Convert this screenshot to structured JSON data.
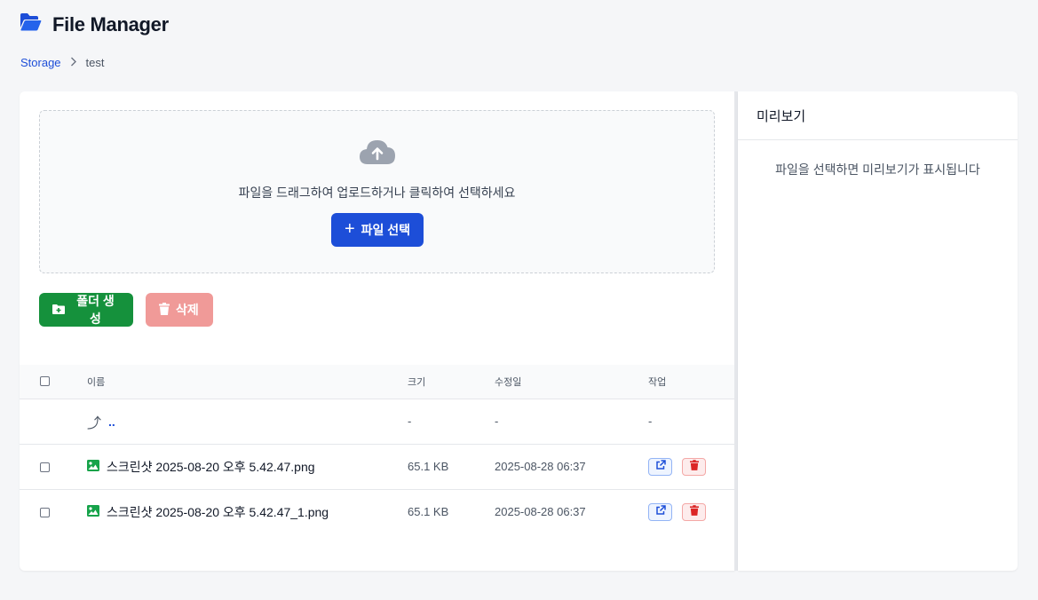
{
  "app": {
    "title": "File Manager",
    "icon": "folder-open-icon"
  },
  "breadcrumb": {
    "root": "Storage",
    "separator_icon": "chevron-right-icon",
    "current": "test"
  },
  "upload": {
    "icon": "cloud-upload-icon",
    "hint": "파일을 드래그하여 업로드하거나 클릭하여 선택하세요",
    "select_button": "파일 선택"
  },
  "toolbar": {
    "create_folder": "폴더 생성",
    "delete": "삭제"
  },
  "table": {
    "headers": {
      "name": "이름",
      "size": "크기",
      "modified": "수정일",
      "actions": "작업"
    },
    "parent_row": {
      "name": "..",
      "size": "-",
      "modified": "-",
      "actions": "-"
    },
    "rows": [
      {
        "name": "스크린샷 2025-08-20 오후 5.42.47.png",
        "size": "65.1 KB",
        "modified": "2025-08-28 06:37",
        "icon": "image-icon"
      },
      {
        "name": "스크린샷 2025-08-20 오후 5.42.47_1.png",
        "size": "65.1 KB",
        "modified": "2025-08-28 06:37",
        "icon": "image-icon"
      }
    ]
  },
  "preview": {
    "title": "미리보기",
    "empty_text": "파일을 선택하면 미리보기가 표시됩니다"
  },
  "colors": {
    "primary": "#1d4ed8",
    "success": "#15913c",
    "danger_light": "#f09a98",
    "danger": "#dc2626"
  }
}
